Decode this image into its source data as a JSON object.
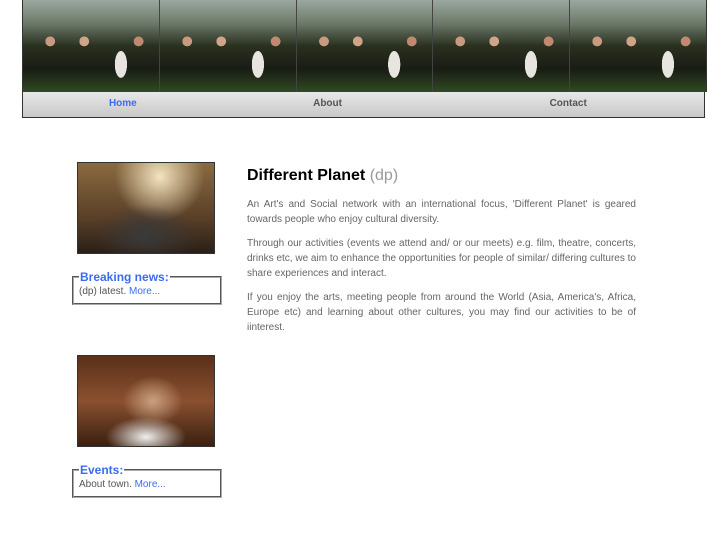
{
  "nav": {
    "items": [
      {
        "label": "Home",
        "active": true
      },
      {
        "label": "About"
      },
      {
        "label": "Contact"
      }
    ]
  },
  "sidebar": {
    "breaking": {
      "title": "Breaking news:",
      "text": "(dp) latest.",
      "link": "More..."
    },
    "events": {
      "title": "Events:",
      "text": "About town.",
      "link": "More..."
    }
  },
  "main": {
    "title": "Different Planet",
    "title_suffix": "(dp)",
    "paragraphs": [
      "An Art's and Social network with an international focus, 'Different Planet' is geared towards people who enjoy cultural diversity.",
      "Through our activities (events we attend and/ or our meets) e.g. film, theatre, concerts, drinks etc, we aim to enhance the opportunities for people of similar/ differing cultures to share experiences and interact.",
      "If you enjoy the arts, meeting people from around the World (Asia, America's, Africa, Europe etc) and learning about other cultures, you may find our activities to be of iinterest."
    ]
  }
}
